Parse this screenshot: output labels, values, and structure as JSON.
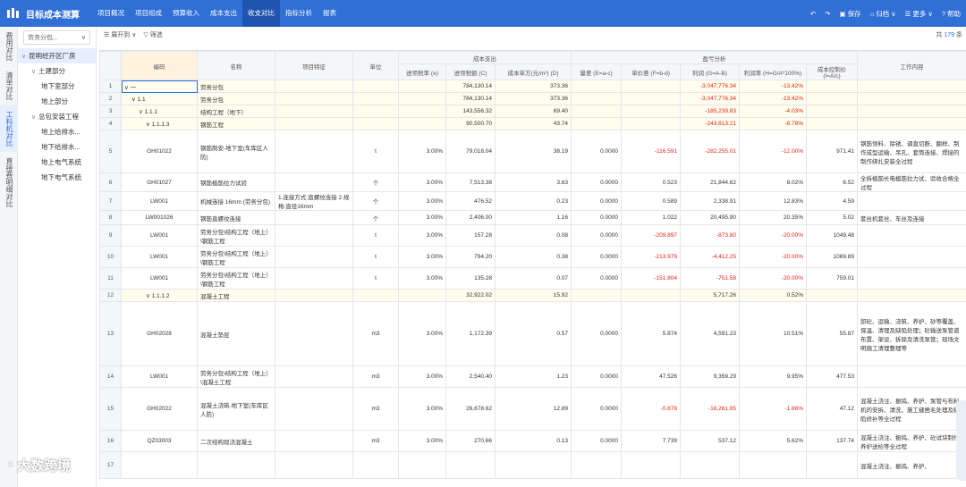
{
  "app": {
    "title": "目标成本测算",
    "brand_color": "#2f6fd6"
  },
  "nav": {
    "tabs": [
      "项目概况",
      "项目组成",
      "预算收入",
      "成本支出",
      "收支对比",
      "指标分析",
      "报表"
    ],
    "active": "收支对比"
  },
  "actions": {
    "undo": "↶",
    "redo": "↷",
    "save": "保存",
    "archive": "归档",
    "more": "更多",
    "help": "帮助"
  },
  "vtabs": [
    "费用对比",
    "清单对比",
    "工料机对比",
    "直接费明细对比"
  ],
  "tree": {
    "select_placeholder": "劳务分包...",
    "root": "昆明经开区厂房",
    "nodes": [
      {
        "label": "土建部分",
        "level": 1,
        "caret": true
      },
      {
        "label": "地下室部分",
        "level": 2,
        "caret": false
      },
      {
        "label": "地上部分",
        "level": 2,
        "caret": false
      },
      {
        "label": "总包安装工程",
        "level": 1,
        "caret": true
      },
      {
        "label": "地上给排水...",
        "level": 2,
        "caret": false
      },
      {
        "label": "地下给排水...",
        "level": 2,
        "caret": false
      },
      {
        "label": "地上电气系统",
        "level": 2,
        "caret": false
      },
      {
        "label": "地下电气系统",
        "level": 2,
        "caret": false
      }
    ]
  },
  "toolbar": {
    "expand": "展开到",
    "filter": "筛选",
    "count_prefix": "共",
    "count_value": "179",
    "count_suffix": "条"
  },
  "table": {
    "group_cost": "成本支出",
    "group_profit": "盈亏分析",
    "headers": [
      "编码",
      "名称",
      "项目特征",
      "单位",
      "进项税率 (e)",
      "进项税额 (C)",
      "成本单方(元/m²) (D)",
      "量差 (E=a-c)",
      "单价差 (F=b-d)",
      "利润 (G=A-B)",
      "利润率 (H=G/A*100%)",
      "成本控制价 (I=A/c)",
      "工作内容"
    ],
    "rows": [
      {
        "idx": "1",
        "code": "∨ 一",
        "name": "劳务分包",
        "feature": "",
        "unit": "",
        "rate": "",
        "tax": "784,130.14",
        "unitcost": "373.36",
        "qdiff": "",
        "pdiff": "",
        "profit": "-3,047,776.34",
        "pr": "-13.42%",
        "ctrl": "",
        "work": "",
        "indent": 0
      },
      {
        "idx": "2",
        "code": "∨ 1.1",
        "name": "劳务分包",
        "feature": "",
        "unit": "",
        "rate": "",
        "tax": "784,130.14",
        "unitcost": "373.36",
        "qdiff": "",
        "pdiff": "",
        "profit": "-3,047,776.34",
        "pr": "-13.42%",
        "ctrl": "",
        "work": "",
        "indent": 1
      },
      {
        "idx": "3",
        "code": "∨ 1.1.1",
        "name": "结构工程（地下）",
        "feature": "",
        "unit": "",
        "rate": "",
        "tax": "143,556.32",
        "unitcost": "69.40",
        "qdiff": "",
        "pdiff": "",
        "profit": "-185,239.83",
        "pr": "-4.03%",
        "ctrl": "",
        "work": "",
        "indent": 2
      },
      {
        "idx": "4",
        "code": "∨ 1.1.1.3",
        "name": "钢筋工程",
        "feature": "",
        "unit": "",
        "rate": "",
        "tax": "90,500.70",
        "unitcost": "43.74",
        "qdiff": "",
        "pdiff": "",
        "profit": "-243,613.21",
        "pr": "-8.78%",
        "ctrl": "",
        "work": "",
        "indent": 3
      },
      {
        "idx": "5",
        "code": "GH01022",
        "name": "钢筋制安-地下室(车库区人防)",
        "feature": "",
        "unit": "t",
        "rate": "3.00%",
        "tax": "79,018.04",
        "unitcost": "38.19",
        "qdiff": "0.0000",
        "pdiff": "-116.591",
        "profit": "-282,255.01",
        "pr": "-12.00%",
        "ctrl": "971.41",
        "work": "钢筋领料、除锈、调直切断、翻样、制作成型运输、吊孔、套筒连接、焊接的制作绑扎安装全过程",
        "indent": -1
      },
      {
        "idx": "6",
        "code": "GH01027",
        "name": "钢筋植筋拉力试验",
        "feature": "",
        "unit": "个",
        "rate": "3.00%",
        "tax": "7,513.38",
        "unitcost": "3.63",
        "qdiff": "0.0000",
        "pdiff": "0.523",
        "profit": "21,844.62",
        "pr": "8.02%",
        "ctrl": "6.52",
        "work": "全拆植筋长电植筋拉力试、验收合格全过程",
        "indent": -1
      },
      {
        "idx": "7",
        "code": "LW001",
        "name": "机械连接 16mm (劳务分包)",
        "feature": "1.连接方式:直螺纹连接 2.规格:直径16mm",
        "unit": "个",
        "rate": "3.00%",
        "tax": "476.52",
        "unitcost": "0.23",
        "qdiff": "0.0000",
        "pdiff": "0.589",
        "profit": "2,338.91",
        "pr": "12.83%",
        "ctrl": "4.59",
        "work": "",
        "indent": -1
      },
      {
        "idx": "8",
        "code": "LW001026",
        "name": "钢筋直螺纹连接",
        "feature": "",
        "unit": "个",
        "rate": "3.00%",
        "tax": "2,406.00",
        "unitcost": "1.16",
        "qdiff": "0.0000",
        "pdiff": "1.022",
        "profit": "20,495.90",
        "pr": "20.35%",
        "ctrl": "5.02",
        "work": "套丝机套丝、车丝及连接",
        "indent": -1
      },
      {
        "idx": "9",
        "code": "LW001",
        "name": "劳务分包\\结构工程（地上）\\钢筋工程",
        "feature": "",
        "unit": "t",
        "rate": "3.00%",
        "tax": "157.28",
        "unitcost": "0.08",
        "qdiff": "0.0000",
        "pdiff": "-209.897",
        "profit": "-873.80",
        "pr": "-20.00%",
        "ctrl": "1049.48",
        "work": "",
        "indent": -1
      },
      {
        "idx": "10",
        "code": "LW001",
        "name": "劳务分包\\结构工程（地上）\\钢筋工程",
        "feature": "",
        "unit": "t",
        "rate": "3.00%",
        "tax": "794.20",
        "unitcost": "0.38",
        "qdiff": "0.0000",
        "pdiff": "-213.979",
        "profit": "-4,412.25",
        "pr": "-20.00%",
        "ctrl": "1069.89",
        "work": "",
        "indent": -1
      },
      {
        "idx": "11",
        "code": "LW001",
        "name": "劳务分包\\结构工程（地上）\\钢筋工程",
        "feature": "",
        "unit": "t",
        "rate": "3.00%",
        "tax": "135.28",
        "unitcost": "0.07",
        "qdiff": "0.0000",
        "pdiff": "-151.804",
        "profit": "-751.58",
        "pr": "-20.00%",
        "ctrl": "759.01",
        "work": "",
        "indent": -1
      },
      {
        "idx": "12",
        "code": "∨ 1.1.1.2",
        "name": "混凝土工程",
        "feature": "",
        "unit": "",
        "rate": "",
        "tax": "32,922.02",
        "unitcost": "15.92",
        "qdiff": "",
        "pdiff": "",
        "profit": "5,717.26",
        "pr": "0.52%",
        "ctrl": "",
        "work": "",
        "indent": 3
      },
      {
        "idx": "13",
        "code": "GH02028",
        "name": "混凝土垫层",
        "feature": "",
        "unit": "m3",
        "rate": "3.00%",
        "tax": "1,172.39",
        "unitcost": "0.57",
        "qdiff": "0.0000",
        "pdiff": "5.874",
        "profit": "4,591.23",
        "pr": "10.51%",
        "ctrl": "55.87",
        "work": "卸砼、运输、浇筑、养护、砂等覆盖、保温、清理及缺陷处理；砼输送泵管道布置、架设、拆除及清洗泵管；现场文明施工清理整理等",
        "indent": -1
      },
      {
        "idx": "14",
        "code": "LW001",
        "name": "劳务分包\\结构工程（地上）\\混凝土工程",
        "feature": "",
        "unit": "m3",
        "rate": "3.00%",
        "tax": "2,540.40",
        "unitcost": "1.23",
        "qdiff": "0.0000",
        "pdiff": "47.526",
        "profit": "9,359.29",
        "pr": "9.95%",
        "ctrl": "477.53",
        "work": "",
        "indent": -1
      },
      {
        "idx": "15",
        "code": "GH02022",
        "name": "混凝土浇筑-地下室(车库区人防)",
        "feature": "",
        "unit": "m3",
        "rate": "3.00%",
        "tax": "26,678.62",
        "unitcost": "12.89",
        "qdiff": "0.0000",
        "pdiff": "-0.878",
        "profit": "-16,261.85",
        "pr": "-1.86%",
        "ctrl": "47.12",
        "work": "混凝土浇注、振捣、养护、泵管与布料机的安拆、清洗、施工缝凿毛处理及缺陷修补等全过程",
        "indent": -1
      },
      {
        "idx": "16",
        "code": "QZ03003",
        "name": "二次结构现浇混凝土",
        "feature": "",
        "unit": "m3",
        "rate": "3.00%",
        "tax": "270.66",
        "unitcost": "0.13",
        "qdiff": "0.0000",
        "pdiff": "7.739",
        "profit": "537.12",
        "pr": "5.62%",
        "ctrl": "137.74",
        "work": "混凝土浇注、振捣、养护、砼试块制作养护送检等全过程",
        "indent": -1
      },
      {
        "idx": "17",
        "code": "",
        "name": "",
        "feature": "",
        "unit": "",
        "rate": "",
        "tax": "",
        "unitcost": "",
        "qdiff": "",
        "pdiff": "",
        "profit": "",
        "pr": "",
        "ctrl": "",
        "work": "混凝土浇注、振捣、养护、",
        "indent": -1
      }
    ]
  },
  "watermark": {
    "text": "大数跨境"
  }
}
